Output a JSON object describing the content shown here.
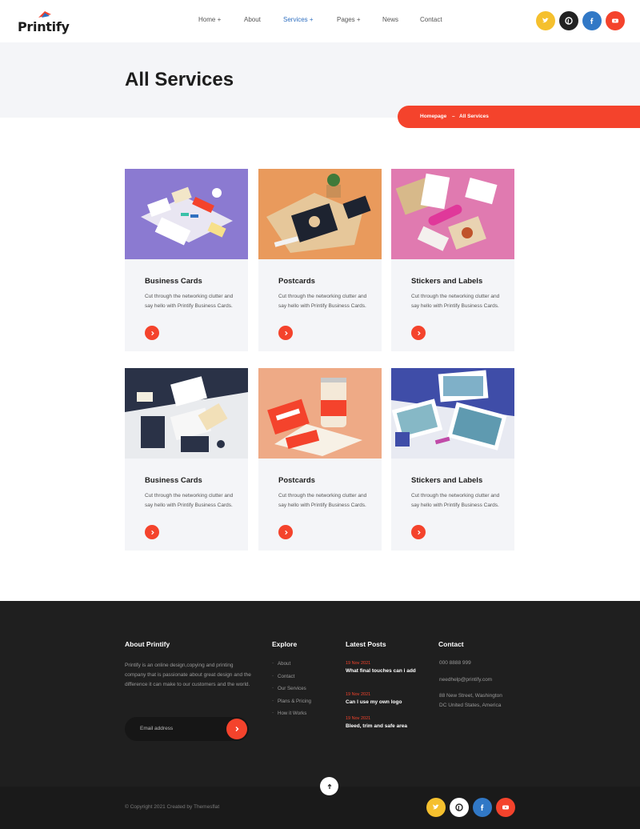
{
  "brand": {
    "name": "Printify",
    "accent": "#f4432c",
    "dark": "#1f1f1f",
    "link_active": "#2f6fc0"
  },
  "nav": {
    "items": [
      {
        "label": "Home +",
        "active": false
      },
      {
        "label": "About",
        "active": false
      },
      {
        "label": "Services +",
        "active": true
      },
      {
        "label": "Pages +",
        "active": false
      },
      {
        "label": "News",
        "active": false
      },
      {
        "label": "Contact",
        "active": false
      }
    ]
  },
  "social": [
    {
      "icon": "twitter-icon",
      "color": "#f5c02e"
    },
    {
      "icon": "pinterest-icon",
      "color": "#222222"
    },
    {
      "icon": "facebook-icon",
      "color": "#3178c6"
    },
    {
      "icon": "youtube-icon",
      "color": "#f4432c"
    }
  ],
  "hero": {
    "title": "All Services"
  },
  "breadcrumb": {
    "home": "Homepage",
    "separator": "–",
    "current": "All Services"
  },
  "services": [
    {
      "title": "Business Cards",
      "desc": "Cut through the networking clutter and say hello with Printify Business Cards."
    },
    {
      "title": "Postcards",
      "desc": "Cut through the networking clutter and say hello with Printify Business Cards."
    },
    {
      "title": "Stickers and Labels",
      "desc": "Cut through the networking clutter and say hello with Printify Business Cards."
    },
    {
      "title": "Business Cards",
      "desc": "Cut through the networking clutter and say hello with Printify Business Cards."
    },
    {
      "title": "Postcards",
      "desc": "Cut through the networking clutter and say hello with Printify Business Cards."
    },
    {
      "title": "Stickers and Labels",
      "desc": "Cut through the networking clutter and say hello with Printify Business Cards."
    }
  ],
  "footer": {
    "about": {
      "heading": "About Printify",
      "text": "Printify is an online design,copying and printing company that is passionate about great design and the difference it can make to our customers and the world.",
      "email_placeholder": "Email address"
    },
    "explore": {
      "heading": "Explore",
      "links": [
        "About",
        "Contact",
        "Our Services",
        "Plans & Pricing",
        "How it Works"
      ]
    },
    "posts": {
      "heading": "Latest Posts",
      "items": [
        {
          "date": "19 Nov 2021",
          "title": "What final touches can i add"
        },
        {
          "date": "19 Nov 2021",
          "title": "Can I use my own logo"
        },
        {
          "date": "19 Nov 2021",
          "title": "Bleed, trim and safe area"
        }
      ]
    },
    "contact": {
      "heading": "Contact",
      "phone": "000 8888 999",
      "email": "needhelp@printify.com",
      "address_line1": "88 New Street, Washington",
      "address_line2": "DC United States, America"
    },
    "copyright": "© Copyright 2021 Created by Themesflat"
  }
}
